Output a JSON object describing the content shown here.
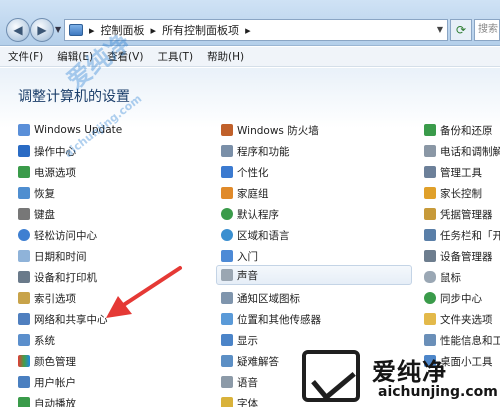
{
  "address": {
    "crumbs": [
      "控制面板",
      "所有控制面板项"
    ]
  },
  "search": {
    "placeholder": "搜索"
  },
  "menu": [
    "文件(F)",
    "编辑(E)",
    "查看(V)",
    "工具(T)",
    "帮助(H)"
  ],
  "page_title": "调整计算机的设置",
  "columns": {
    "col1": [
      "Windows Update",
      "操作中心",
      "电源选项",
      "恢复",
      "键盘",
      "轻松访问中心",
      "日期和时间",
      "设备和打印机",
      "索引选项",
      "网络和共享中心",
      "系统",
      "颜色管理",
      "用户帐户",
      "自动播放"
    ],
    "col2": [
      "Windows 防火墙",
      "程序和功能",
      "个性化",
      "家庭组",
      "默认程序",
      "区域和语言",
      "入门",
      "声音",
      "通知区域图标",
      "位置和其他传感器",
      "显示",
      "疑难解答",
      "语音",
      "字体"
    ],
    "col3": [
      "备份和还原",
      "电话和调制解",
      "管理工具",
      "家长控制",
      "凭据管理器",
      "任务栏和「开",
      "设备管理器",
      "鼠标",
      "同步中心",
      "文件夹选项",
      "性能信息和工",
      "桌面小工具"
    ]
  },
  "watermark": {
    "main": "爱纯净",
    "url": "aichunjing.com",
    "diagonal": "爱纯净",
    "diagonal_url": "aichunjing.com"
  },
  "colors": {
    "arrow": "#e53935",
    "title": "#1c3f6b"
  }
}
